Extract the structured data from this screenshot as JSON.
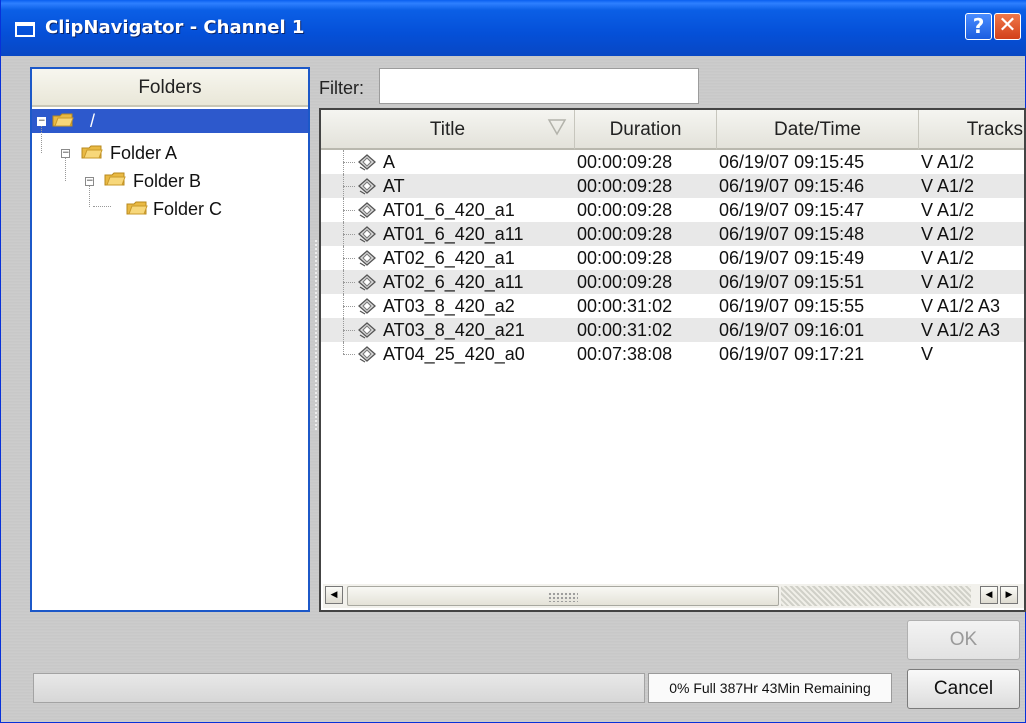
{
  "window": {
    "title": "ClipNavigator - Channel 1",
    "help_glyph": "?",
    "close_glyph": "✕"
  },
  "folders": {
    "header": "Folders",
    "tree": [
      {
        "label": "/",
        "selected": true,
        "expander": "−"
      },
      {
        "label": "Folder A",
        "expander": "−"
      },
      {
        "label": "Folder B",
        "expander": "−"
      },
      {
        "label": "Folder C"
      }
    ]
  },
  "filter": {
    "label": "Filter:",
    "value": ""
  },
  "table": {
    "columns": [
      "Title",
      "Duration",
      "Date/Time",
      "Tracks"
    ],
    "sort_column": "Title",
    "rows": [
      {
        "title": "A",
        "duration": "00:00:09:28",
        "datetime": "06/19/07 09:15:45",
        "tracks": "V A1/2"
      },
      {
        "title": "AT",
        "duration": "00:00:09:28",
        "datetime": "06/19/07 09:15:46",
        "tracks": "V A1/2"
      },
      {
        "title": "AT01_6_420_a1",
        "duration": "00:00:09:28",
        "datetime": "06/19/07 09:15:47",
        "tracks": "V A1/2"
      },
      {
        "title": "AT01_6_420_a11",
        "duration": "00:00:09:28",
        "datetime": "06/19/07 09:15:48",
        "tracks": "V A1/2"
      },
      {
        "title": "AT02_6_420_a1",
        "duration": "00:00:09:28",
        "datetime": "06/19/07 09:15:49",
        "tracks": "V A1/2"
      },
      {
        "title": "AT02_6_420_a11",
        "duration": "00:00:09:28",
        "datetime": "06/19/07 09:15:51",
        "tracks": "V A1/2"
      },
      {
        "title": "AT03_8_420_a2",
        "duration": "00:00:31:02",
        "datetime": "06/19/07 09:15:55",
        "tracks": "V A1/2 A3"
      },
      {
        "title": "AT03_8_420_a21",
        "duration": "00:00:31:02",
        "datetime": "06/19/07 09:16:01",
        "tracks": "V A1/2 A3"
      },
      {
        "title": "AT04_25_420_a0",
        "duration": "00:07:38:08",
        "datetime": "06/19/07 09:17:21",
        "tracks": "V"
      }
    ]
  },
  "scrollbar": {
    "left_glyph": "◀",
    "right_glyph": "▶"
  },
  "status": {
    "progress_fraction": 0.0,
    "text": "0% Full 387Hr 43Min Remaining"
  },
  "buttons": {
    "ok": "OK",
    "cancel": "Cancel"
  },
  "colors": {
    "selection": "#2d59cc",
    "titlebar": "#0550d8",
    "panel_border": "#1c58c8"
  }
}
